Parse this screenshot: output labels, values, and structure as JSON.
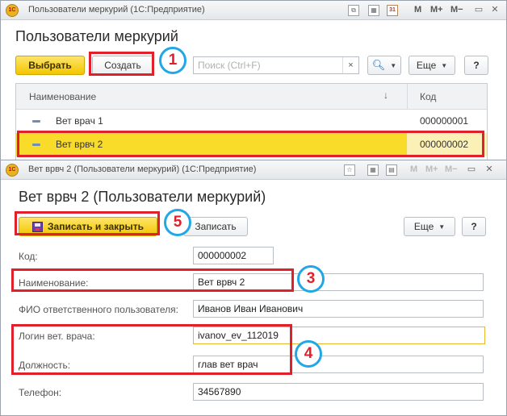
{
  "window1": {
    "titlebar_title": "Пользователи меркурий (1С:Предприятие)",
    "titlebar_m": "M",
    "titlebar_mplus": "M+",
    "titlebar_mminus": "M−",
    "heading": "Пользователи меркурий",
    "toolbar": {
      "select_label": "Выбрать",
      "create_label": "Создать",
      "search_placeholder": "Поиск (Ctrl+F)",
      "search_clear": "×",
      "more_label": "Еще",
      "help_label": "?"
    },
    "table": {
      "columns": [
        "Наименование",
        "Код"
      ],
      "rows": [
        {
          "name": "Вет врач 1",
          "code": "000000001"
        },
        {
          "name": "Вет врвч 2",
          "code": "000000002"
        }
      ]
    }
  },
  "window2": {
    "titlebar_title": "Вет врвч 2 (Пользователи меркурий)  (1С:Предприятие)",
    "heading": "Вет врвч 2 (Пользователи меркурий)",
    "toolbar": {
      "save_close_label": "Записать и закрыть",
      "save_label": "Записать",
      "more_label": "Еще",
      "help_label": "?"
    },
    "fields": {
      "code": {
        "label": "Код:",
        "value": "000000002"
      },
      "name": {
        "label": "Наименование:",
        "value": "Вет врвч 2"
      },
      "responsible": {
        "label": "ФИО ответственного пользователя:",
        "value": "Иванов Иван Иванович"
      },
      "login": {
        "label": "Логин вет. врача:",
        "value": "ivanov_ev_112019"
      },
      "position": {
        "label": "Должность:",
        "value": "глав вет врач"
      },
      "phone": {
        "label": "Телефон:",
        "value": "34567890"
      }
    }
  },
  "annotations": [
    "1",
    "3",
    "4",
    "5"
  ],
  "colors": {
    "accent_yellow": "#f3c600",
    "selection_yellow": "#f9dc2a",
    "annotation_red": "#e0202b",
    "annotation_blue": "#22a7e6"
  }
}
